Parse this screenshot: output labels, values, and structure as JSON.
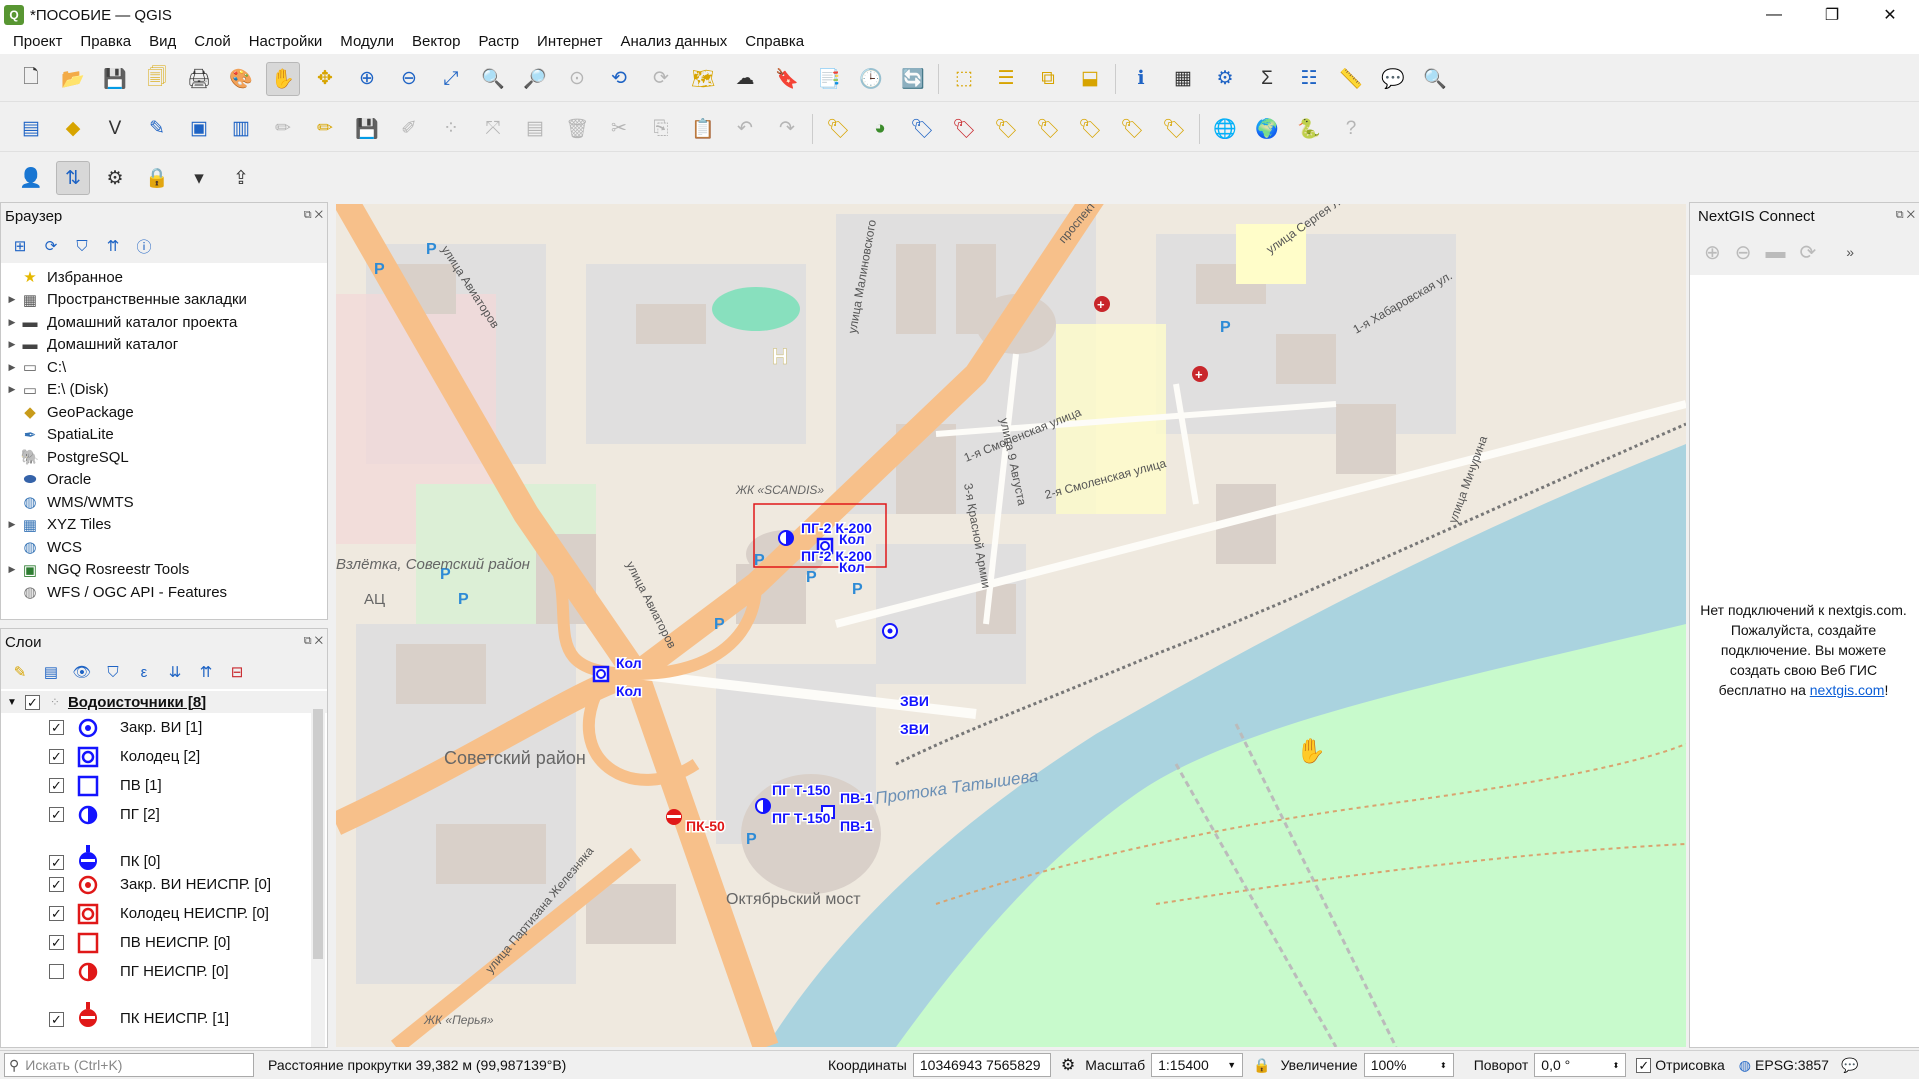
{
  "window": {
    "title": "*ПОСОБИЕ — QGIS",
    "app_icon": "Q",
    "min_glyph": "—",
    "max_glyph": "❐",
    "close_glyph": "✕"
  },
  "menu": [
    "Проект",
    "Правка",
    "Вид",
    "Слой",
    "Настройки",
    "Модули",
    "Вектор",
    "Растр",
    "Интернет",
    "Анализ данных",
    "Справка"
  ],
  "browser": {
    "title": "Браузер",
    "items": [
      {
        "label": "Избранное",
        "icon": "star-icon",
        "glyph": "★",
        "color": "#e5b800",
        "expand": false
      },
      {
        "label": "Пространственные закладки",
        "icon": "bookmark-icon",
        "glyph": "▦",
        "color": "#555",
        "expand": true
      },
      {
        "label": "Домашний каталог проекта",
        "icon": "folder-icon",
        "glyph": "▬",
        "color": "#444",
        "expand": true
      },
      {
        "label": "Домашний каталог",
        "icon": "folder-icon",
        "glyph": "▬",
        "color": "#444",
        "expand": true
      },
      {
        "label": "C:\\",
        "icon": "drive-icon",
        "glyph": "▭",
        "color": "#666",
        "expand": true
      },
      {
        "label": "E:\\ (Disk)",
        "icon": "drive-icon",
        "glyph": "▭",
        "color": "#666",
        "expand": true
      },
      {
        "label": "GeoPackage",
        "icon": "geopackage-icon",
        "glyph": "◆",
        "color": "#c89b1a",
        "expand": false
      },
      {
        "label": "SpatiaLite",
        "icon": "spatialite-icon",
        "glyph": "✒",
        "color": "#3573b5",
        "expand": false
      },
      {
        "label": "PostgreSQL",
        "icon": "postgresql-icon",
        "glyph": "🐘",
        "color": "#336791",
        "expand": false
      },
      {
        "label": "Oracle",
        "icon": "oracle-icon",
        "glyph": "⬬",
        "color": "#3563a9",
        "expand": false
      },
      {
        "label": "WMS/WMTS",
        "icon": "globe-icon",
        "glyph": "◍",
        "color": "#3573b5",
        "expand": false
      },
      {
        "label": "XYZ Tiles",
        "icon": "tiles-icon",
        "glyph": "▦",
        "color": "#3573b5",
        "expand": true
      },
      {
        "label": "WCS",
        "icon": "globe-icon",
        "glyph": "◍",
        "color": "#3573b5",
        "expand": false
      },
      {
        "label": "NGQ Rosreestr Tools",
        "icon": "rosreestr-icon",
        "glyph": "▣",
        "color": "#2e7d32",
        "expand": true
      },
      {
        "label": "WFS / OGC API - Features",
        "icon": "wfs-icon",
        "glyph": "◍",
        "color": "#777",
        "expand": false
      }
    ]
  },
  "layers": {
    "title": "Слои",
    "group": "Водоисточники [8]",
    "items": [
      {
        "label": "Закр. ВИ [1]",
        "checked": true,
        "sym": "closed",
        "color": "#1414ff"
      },
      {
        "label": "Колодец [2]",
        "checked": true,
        "sym": "well",
        "color": "#1414ff"
      },
      {
        "label": "ПВ [1]",
        "checked": true,
        "sym": "square",
        "color": "#1414ff"
      },
      {
        "label": "ПГ [2]",
        "checked": true,
        "sym": "half",
        "color": "#1414ff"
      },
      {
        "label": "ПК [0]",
        "checked": true,
        "sym": "pk",
        "color": "#1414ff"
      },
      {
        "label": "Закр. ВИ НЕИСПР. [0]",
        "checked": true,
        "sym": "closed",
        "color": "#e01818"
      },
      {
        "label": "Колодец НЕИСПР. [0]",
        "checked": true,
        "sym": "well",
        "color": "#e01818"
      },
      {
        "label": "ПВ НЕИСПР. [0]",
        "checked": true,
        "sym": "square",
        "color": "#e01818"
      },
      {
        "label": "ПГ НЕИСПР. [0]",
        "checked": false,
        "sym": "half",
        "color": "#e01818"
      },
      {
        "label": "ПК НЕИСПР. [1]",
        "checked": true,
        "sym": "pk",
        "color": "#e01818"
      }
    ]
  },
  "nextgis": {
    "title": "NextGIS Connect",
    "message": "Нет подключений к nextgis.com. Пожалуйста, создайте подключение. Вы можете создать свою Веб ГИС бесплатно на",
    "link": "nextgis.com",
    "suffix": "!"
  },
  "map": {
    "streets": [
      "улица Авиаторов",
      "улица Авиаторов",
      "улица Партизана Железняка",
      "проспект",
      "улица Малиновского",
      "улица Сергея Лазо",
      "1-я Смоленская улица",
      "2-я Смоленская улица",
      "3-я Красной Армии",
      "улица 9 Августа",
      "1-я Хабаровская ул.",
      "улица Мичурина"
    ],
    "places": [
      "Советский район",
      "Октябрьский мост",
      "Протока Татышева",
      "ЖК «SCANDIS»",
      "Взлётка, Советский район",
      "ЖК «Перья»",
      "АЦ"
    ],
    "labels": [
      {
        "text": "Кол",
        "color": "#1414ff"
      },
      {
        "text": "Кол",
        "color": "#1414ff"
      },
      {
        "text": "Кол",
        "color": "#1414ff"
      },
      {
        "text": "Кол",
        "color": "#1414ff"
      },
      {
        "text": "ПГ-2 К-200",
        "color": "#1414ff"
      },
      {
        "text": "ПГ-2 К-200",
        "color": "#1414ff"
      },
      {
        "text": "ЗВИ",
        "color": "#1414ff"
      },
      {
        "text": "ЗВИ",
        "color": "#1414ff"
      },
      {
        "text": "ПГ Т-150",
        "color": "#1414ff"
      },
      {
        "text": "ПГ Т-150",
        "color": "#1414ff"
      },
      {
        "text": "ПВ-1",
        "color": "#1414ff"
      },
      {
        "text": "ПВ-1",
        "color": "#1414ff"
      },
      {
        "text": "ПК-50",
        "color": "#e01818"
      }
    ],
    "parking": "P",
    "hospital": "+",
    "h_marker": "H"
  },
  "status": {
    "search_placeholder": "Искать (Ctrl+K)",
    "message": "Расстояние прокрутки 39,382 м (99,987139°В)",
    "coord_label": "Координаты",
    "coord_value": "10346943  7565829",
    "scale_label": "Масштаб",
    "scale_value": "1:15400",
    "zoom_label": "Увеличение",
    "zoom_value": "100%",
    "rotation_label": "Поворот",
    "rotation_value": "0,0 °",
    "render_label": "Отрисовка",
    "crs": "EPSG:3857"
  },
  "colors": {
    "accent": "#1e63c4",
    "water": "#aad3df",
    "park": "#c8facc",
    "road": "#f7c08a",
    "building": "#d9d0c9",
    "residential": "#e0dfdf"
  }
}
